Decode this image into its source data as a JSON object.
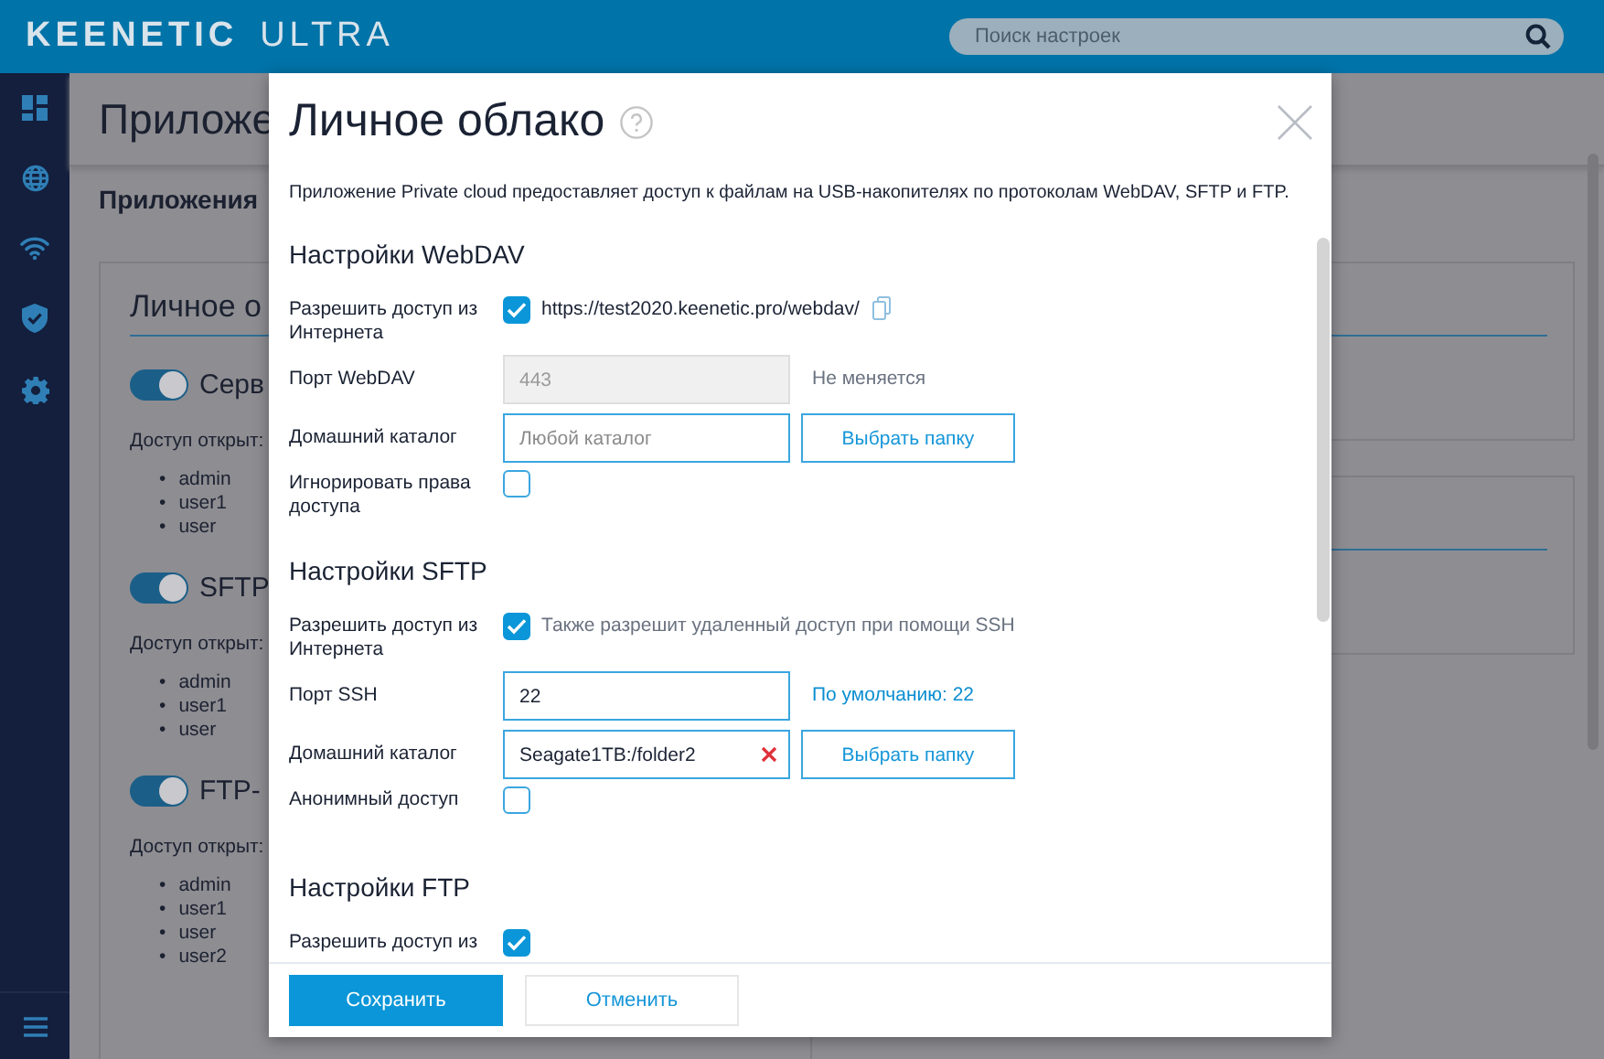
{
  "header": {
    "brand": "KEENETIC",
    "model": "ULTRA",
    "search": {
      "placeholder": "Поиск настроек"
    }
  },
  "page": {
    "title": "Приложе",
    "tabs": [
      {
        "label": "Приложения",
        "selected": true
      }
    ],
    "card": {
      "title": "Личное о",
      "bullet": "•",
      "services": [
        {
          "name": "Серв",
          "on": true,
          "access_label": "Доступ открыт:",
          "users": [
            "admin",
            "user1",
            "user"
          ]
        },
        {
          "name": "SFTP",
          "on": true,
          "access_label": "Доступ открыт:",
          "users": [
            "admin",
            "user1",
            "user"
          ]
        },
        {
          "name": "FTP-",
          "on": true,
          "access_label": "Доступ открыт:",
          "users": [
            "admin",
            "user1",
            "user",
            "user2"
          ]
        }
      ]
    }
  },
  "dialog": {
    "title": "Личное облако",
    "description": "Приложение Private cloud предоставляет доступ к файлам на USB-накопителях по протоколам WebDAV, SFTP и FTP.",
    "sections": [
      {
        "title": "Настройки WebDAV",
        "rows": [
          {
            "kind": "checkbox",
            "label": "Разрешить доступ из Интернета",
            "checked": true,
            "url": "https://test2020.keenetic.pro/webdav/"
          },
          {
            "kind": "input",
            "label": "Порт WebDAV",
            "value": "443",
            "disabled": true,
            "hint": {
              "text": "Не меняется",
              "kind": "plain"
            }
          },
          {
            "kind": "input",
            "label": "Домашний каталог",
            "placeholder": "Любой каталог",
            "disabled": false,
            "button": "Выбрать папку"
          },
          {
            "kind": "checkbox",
            "label": "Игнорировать права доступа",
            "checked": false
          }
        ]
      },
      {
        "title": "Настройки SFTP",
        "rows": [
          {
            "kind": "checkbox",
            "label": "Разрешить доступ из Интернета",
            "checked": true,
            "note": "Также разрешит удаленный доступ при помощи SSH"
          },
          {
            "kind": "input",
            "label": "Порт SSH",
            "value": "22",
            "disabled": false,
            "hint": {
              "text": "По умолчанию: 22",
              "kind": "link"
            }
          },
          {
            "kind": "input",
            "label": "Домашний каталог",
            "value": "Seagate1TB:/folder2",
            "disabled": false,
            "clearable": true,
            "button": "Выбрать папку"
          },
          {
            "kind": "checkbox",
            "label": "Анонимный доступ",
            "checked": false
          }
        ]
      },
      {
        "title": "Настройки FTP",
        "rows": [
          {
            "kind": "checkbox",
            "label": "Разрешить доступ из",
            "checked": true
          }
        ]
      }
    ],
    "buttons": [
      {
        "label": "Сохранить",
        "kind": "primary"
      },
      {
        "label": "Отменить",
        "kind": "secondary"
      }
    ]
  }
}
